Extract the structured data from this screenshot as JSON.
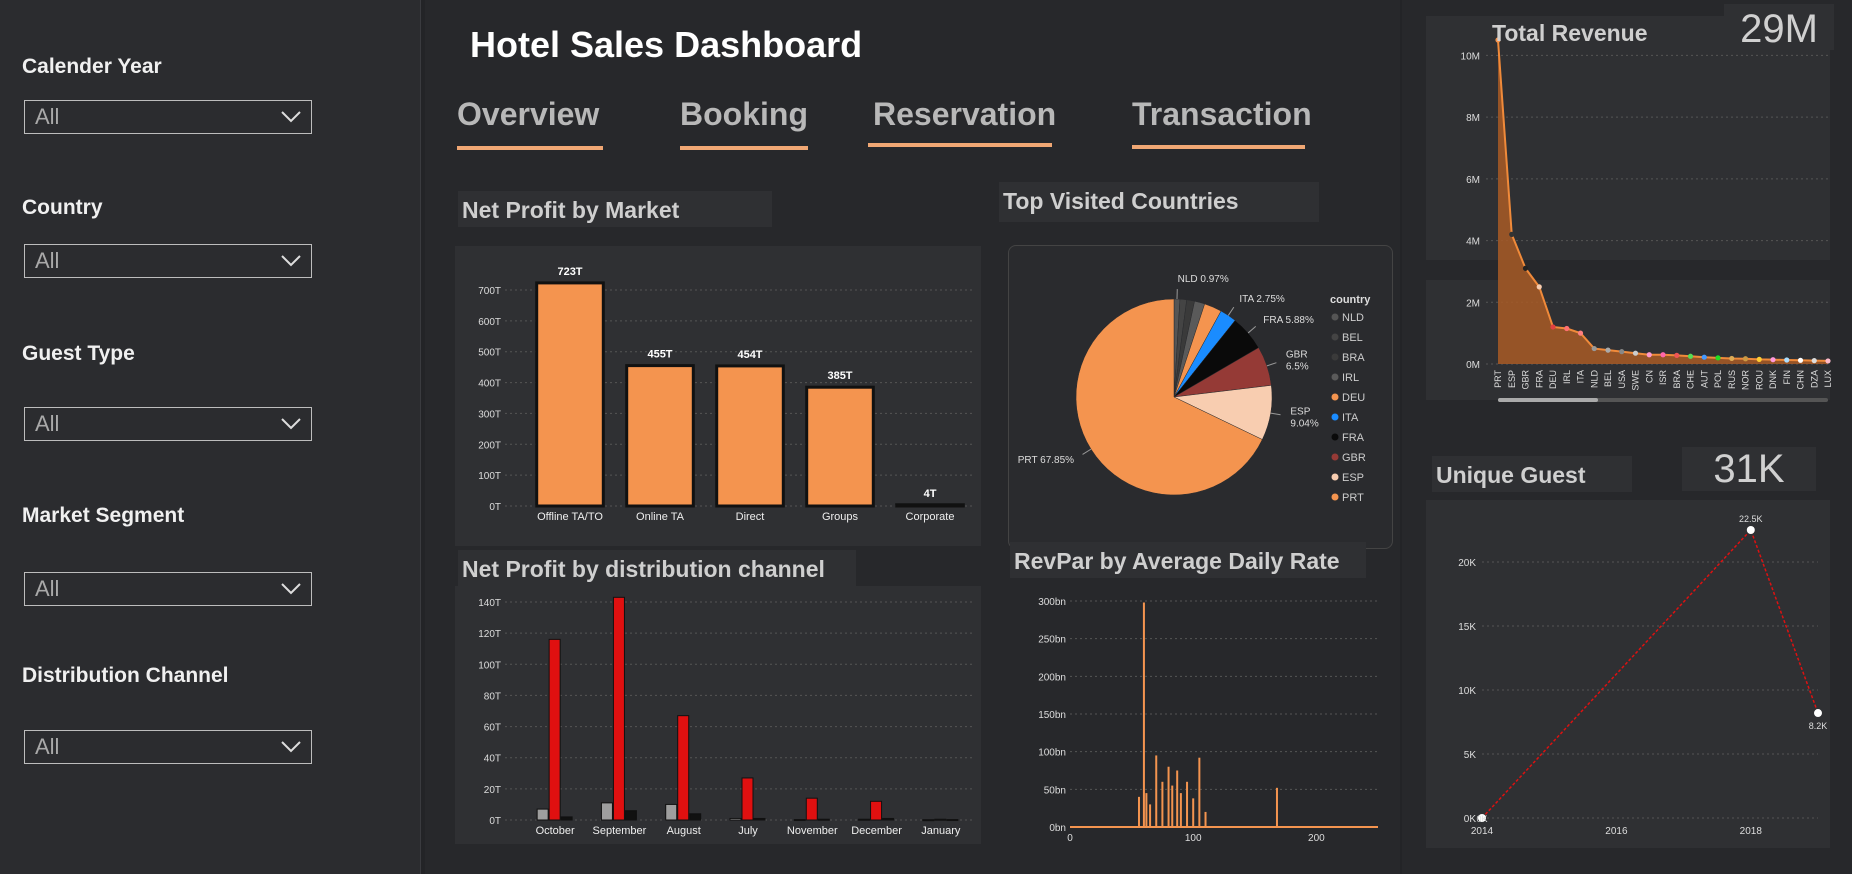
{
  "title": "Hotel Sales Dashboard",
  "tabs": [
    {
      "label": "Overview"
    },
    {
      "label": "Booking"
    },
    {
      "label": "Reservation"
    },
    {
      "label": "Transaction"
    }
  ],
  "slicers": [
    {
      "label": "Calender Year",
      "value": "All"
    },
    {
      "label": "Country",
      "value": "All"
    },
    {
      "label": "Guest Type",
      "value": "All"
    },
    {
      "label": "Market Segment",
      "value": "All"
    },
    {
      "label": "Distribution Channel",
      "value": "All"
    }
  ],
  "cards": {
    "net_profit_market": "Net Profit by Market",
    "top_countries": "Top Visited Countries",
    "net_profit_channel": "Net Profit by distribution channel",
    "revpar": "RevPar by Average Daily Rate",
    "total_revenue": "Total Revenue",
    "total_revenue_value": "29M",
    "unique_guest": "Unique Guest",
    "unique_guest_value": "31K"
  },
  "colors": {
    "accent": "#f4944f",
    "red": "#e01010",
    "grey": "#9e9e9e",
    "dark": "#111111"
  },
  "chart_data": [
    {
      "id": "net_profit_market",
      "type": "bar",
      "categories": [
        "Offline TA/TO",
        "Online TA",
        "Direct",
        "Groups",
        "Corporate"
      ],
      "values": [
        723,
        455,
        454,
        385,
        4
      ],
      "data_labels": [
        "723T",
        "455T",
        "454T",
        "385T",
        "4T"
      ],
      "yticks": [
        "0T",
        "100T",
        "200T",
        "300T",
        "400T",
        "500T",
        "600T",
        "700T"
      ],
      "ylim": [
        0,
        700
      ]
    },
    {
      "id": "top_countries",
      "type": "pie",
      "legend_title": "country",
      "slices": [
        {
          "label": "PRT",
          "value": 67.85,
          "display": "PRT 67.85%",
          "color": "#f4944f"
        },
        {
          "label": "ESP",
          "value": 9.04,
          "display": "ESP 9.04%",
          "color": "#f8cdb0"
        },
        {
          "label": "GBR",
          "value": 6.5,
          "display": "GBR 6.5%",
          "color": "#953a36"
        },
        {
          "label": "FRA",
          "value": 5.88,
          "display": "FRA 5.88%",
          "color": "#0a0a0a"
        },
        {
          "label": "ITA",
          "value": 2.75,
          "display": "ITA 2.75%",
          "color": "#1a8cff"
        },
        {
          "label": "DEU",
          "value": 2.9,
          "display": "",
          "color": "#f4944f"
        },
        {
          "label": "IRL",
          "value": 1.7,
          "display": "",
          "color": "#5a5a5a"
        },
        {
          "label": "BRA",
          "value": 1.3,
          "display": "",
          "color": "#3a3a3a"
        },
        {
          "label": "BEL",
          "value": 1.1,
          "display": "",
          "color": "#444444"
        },
        {
          "label": "NLD",
          "value": 0.97,
          "display": "NLD 0.97%",
          "color": "#555555"
        }
      ],
      "legend": [
        "NLD",
        "BEL",
        "BRA",
        "IRL",
        "DEU",
        "ITA",
        "FRA",
        "GBR",
        "ESP",
        "PRT"
      ]
    },
    {
      "id": "net_profit_channel",
      "type": "bar",
      "categories": [
        "October",
        "September",
        "August",
        "July",
        "November",
        "December",
        "January"
      ],
      "series": [
        {
          "color": "#9e9e9e",
          "values": [
            7,
            11,
            10,
            1,
            0.3,
            0.5,
            0.2
          ]
        },
        {
          "color": "#e01010",
          "values": [
            116,
            143,
            67,
            27,
            14,
            12,
            0.5
          ]
        },
        {
          "color": "#111111",
          "values": [
            2,
            6,
            4,
            1,
            0.5,
            1,
            0.3
          ]
        }
      ],
      "yticks": [
        "0T",
        "20T",
        "40T",
        "60T",
        "80T",
        "100T",
        "120T",
        "140T"
      ],
      "ylim": [
        0,
        140
      ]
    },
    {
      "id": "revpar",
      "type": "bar",
      "xticks": [
        "0",
        "100",
        "200"
      ],
      "yticks": [
        "0bn",
        "50bn",
        "100bn",
        "150bn",
        "200bn",
        "250bn",
        "300bn"
      ],
      "xlim": [
        0,
        250
      ],
      "ylim": [
        0,
        300
      ],
      "peaks": [
        {
          "x": 56,
          "y": 40
        },
        {
          "x": 60,
          "y": 298
        },
        {
          "x": 62,
          "y": 45
        },
        {
          "x": 65,
          "y": 30
        },
        {
          "x": 70,
          "y": 95
        },
        {
          "x": 75,
          "y": 60
        },
        {
          "x": 80,
          "y": 80
        },
        {
          "x": 83,
          "y": 55
        },
        {
          "x": 87,
          "y": 75
        },
        {
          "x": 90,
          "y": 45
        },
        {
          "x": 95,
          "y": 60
        },
        {
          "x": 100,
          "y": 38
        },
        {
          "x": 105,
          "y": 92
        },
        {
          "x": 110,
          "y": 20
        },
        {
          "x": 168,
          "y": 52
        }
      ]
    },
    {
      "id": "total_revenue",
      "type": "area",
      "categories": [
        "PRT",
        "ESP",
        "GBR",
        "FRA",
        "DEU",
        "IRL",
        "ITA",
        "NLD",
        "BEL",
        "USA",
        "SWE",
        "CN",
        "ISR",
        "BRA",
        "CHE",
        "AUT",
        "POL",
        "RUS",
        "NOR",
        "ROU",
        "DNK",
        "FIN",
        "CHN",
        "DZA",
        "LUX"
      ],
      "values": [
        10.5,
        4.2,
        3.1,
        2.5,
        1.2,
        1.15,
        1.0,
        0.5,
        0.45,
        0.4,
        0.35,
        0.3,
        0.3,
        0.28,
        0.25,
        0.22,
        0.2,
        0.18,
        0.17,
        0.15,
        0.14,
        0.13,
        0.12,
        0.11,
        0.1
      ],
      "yticks": [
        "0M",
        "2M",
        "4M",
        "6M",
        "8M",
        "10M"
      ],
      "ylim": [
        0,
        10.5
      ]
    },
    {
      "id": "unique_guest",
      "type": "line",
      "x": [
        2014,
        2018,
        2019
      ],
      "y": [
        0,
        22.5,
        8.2
      ],
      "labels": [
        "0K",
        "22.5K",
        "8.2K"
      ],
      "xticks": [
        "2014",
        "2016",
        "2018"
      ],
      "yticks": [
        "0K",
        "5K",
        "10K",
        "15K",
        "20K"
      ],
      "xlim": [
        2014,
        2019
      ],
      "ylim": [
        0,
        22.5
      ]
    }
  ]
}
